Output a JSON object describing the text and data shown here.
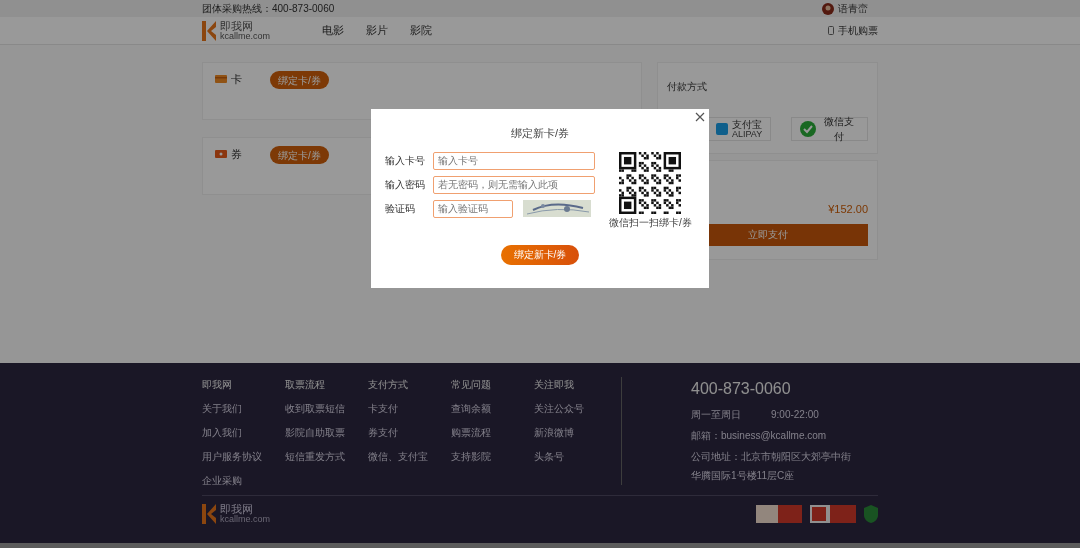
{
  "top_bar": {
    "hotline": "团体采购热线：400-873-0060",
    "user": "语青峦"
  },
  "nav": {
    "logo": "即我网",
    "logo_sub": "kcallme.com",
    "items": [
      {
        "label": "电影",
        "selected": false
      },
      {
        "label": "影片",
        "selected": false
      },
      {
        "label": "影院",
        "selected": false
      }
    ],
    "mobile": "手机购票"
  },
  "sections": [
    {
      "kind": "card",
      "title": "卡",
      "button": "绑定卡/券"
    },
    {
      "kind": "coupon",
      "title": "券",
      "button": "绑定卡/券"
    }
  ],
  "payment": {
    "title": "付款方式",
    "methods": [
      {
        "kind": "alipay",
        "label": "支付宝",
        "sub": "ALIPAY"
      },
      {
        "kind": "wechat",
        "label": "微信支付"
      }
    ],
    "total": "¥152.00",
    "pay_button": "立即支付"
  },
  "dialog": {
    "title": "绑定新卡/券",
    "fields": [
      {
        "label": "输入卡号",
        "placeholder": "输入卡号",
        "kind": "wide"
      },
      {
        "label": "输入密码",
        "placeholder": "若无密码，则无需输入此项",
        "kind": "wide"
      },
      {
        "label": "验证码",
        "placeholder": "输入验证码",
        "kind": "captcha"
      }
    ],
    "qr_caption": "微信扫一扫绑卡/券",
    "submit": "绑定新卡/券"
  },
  "footer": {
    "logo": "即我网",
    "logo_sub": "kcallme.com",
    "columns": [
      {
        "heading": "即我网",
        "links": [
          "关于我们",
          "加入我们",
          "用户服务协议",
          "企业采购"
        ]
      },
      {
        "heading": "取票流程",
        "links": [
          "收到取票短信",
          "影院自助取票",
          "短信重发方式"
        ]
      },
      {
        "heading": "支付方式",
        "links": [
          "卡支付",
          "券支付",
          "微信、支付宝"
        ]
      },
      {
        "heading": "常见问题",
        "links": [
          "查询余额",
          "购票流程",
          "支持影院"
        ]
      },
      {
        "heading": "关注即我",
        "links": [
          "关注公众号",
          "新浪微博",
          "头条号"
        ]
      }
    ],
    "phone": "400-873-0060",
    "hours_days": "周一至周日",
    "hours_time": "9:00-22:00",
    "email": "邮箱：business@kcallme.com",
    "address": [
      "公司地址：北京市朝阳区大郊亭中街",
      "华腾国际1号楼11层C座"
    ]
  }
}
